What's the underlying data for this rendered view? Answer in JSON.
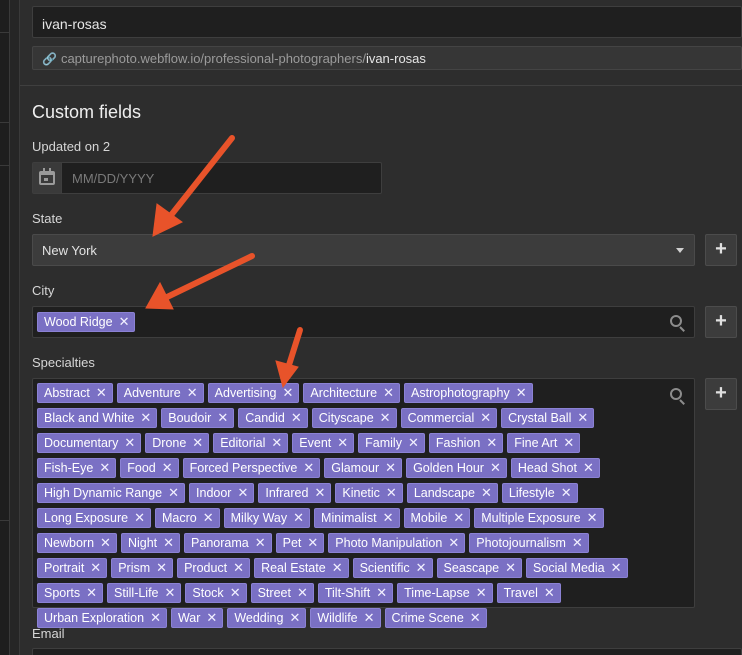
{
  "slug": {
    "value": "ivan-rosas"
  },
  "url": {
    "prefix": "capturephoto.webflow.io/professional-photographers/",
    "slug": "ivan-rosas"
  },
  "section": {
    "title": "Custom fields"
  },
  "updated": {
    "label": "Updated on 2",
    "placeholder": "MM/DD/YYYY"
  },
  "state": {
    "label": "State",
    "selected": "New York",
    "add_label": "+"
  },
  "city": {
    "label": "City",
    "tags": [
      "Wood Ridge"
    ],
    "add_label": "+"
  },
  "specialties": {
    "label": "Specialties",
    "add_label": "+",
    "tags": [
      "Abstract",
      "Adventure",
      "Advertising",
      "Architecture",
      "Astrophotography",
      "Black and White",
      "Boudoir",
      "Candid",
      "Cityscape",
      "Commercial",
      "Crystal Ball",
      "Documentary",
      "Drone",
      "Editorial",
      "Event",
      "Family",
      "Fashion",
      "Fine Art",
      "Fish-Eye",
      "Food",
      "Forced Perspective",
      "Glamour",
      "Golden Hour",
      "Head Shot",
      "High Dynamic Range",
      "Indoor",
      "Infrared",
      "Kinetic",
      "Landscape",
      "Lifestyle",
      "Long Exposure",
      "Macro",
      "Milky Way",
      "Minimalist",
      "Mobile",
      "Multiple Exposure",
      "Newborn",
      "Night",
      "Panorama",
      "Pet",
      "Photo Manipulation",
      "Photojournalism",
      "Portrait",
      "Prism",
      "Product",
      "Real Estate",
      "Scientific",
      "Seascape",
      "Social Media",
      "Sports",
      "Still-Life",
      "Stock",
      "Street",
      "Tilt-Shift",
      "Time-Lapse",
      "Travel",
      "Urban Exploration",
      "War",
      "Wedding",
      "Wildlife",
      "Crime Scene"
    ]
  },
  "email": {
    "label": "Email"
  },
  "icons": {
    "link": "link-icon",
    "calendar": "calendar-icon",
    "search": "search-icon",
    "remove": "remove-x-icon",
    "caret": "chevron-down-icon"
  },
  "colors": {
    "tag": "#7a70c4",
    "annotation_arrow": "#e8532a",
    "panel": "#2d2d2d",
    "field": "#1f1f1f"
  }
}
